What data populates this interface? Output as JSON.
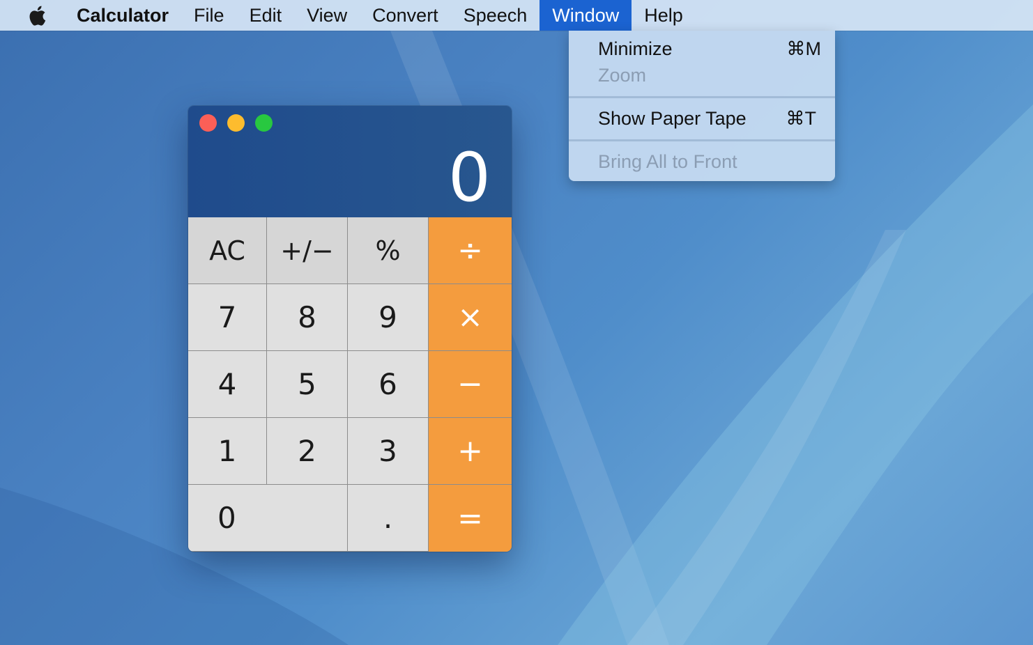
{
  "menubar": {
    "app_name": "Calculator",
    "items": [
      "File",
      "Edit",
      "View",
      "Convert",
      "Speech",
      "Window",
      "Help"
    ],
    "active": "Window"
  },
  "window_menu": {
    "minimize": {
      "label": "Minimize",
      "shortcut": "⌘M"
    },
    "zoom": {
      "label": "Zoom"
    },
    "paper_tape": {
      "label": "Show Paper Tape",
      "shortcut": "⌘T"
    },
    "bring_all": {
      "label": "Bring All to Front"
    }
  },
  "calculator": {
    "display_value": "0",
    "keys": {
      "ac": "AC",
      "sign": "+/−",
      "percent": "%",
      "divide": "÷",
      "seven": "7",
      "eight": "8",
      "nine": "9",
      "multiply": "×",
      "four": "4",
      "five": "5",
      "six": "6",
      "minus": "−",
      "one": "1",
      "two": "2",
      "three": "3",
      "plus": "+",
      "zero": "0",
      "decimal": ".",
      "equals": "="
    }
  },
  "colors": {
    "close": "#fc5f57",
    "minimize": "#fdbc2e",
    "zoom": "#28c840",
    "operator": "#f49c3e",
    "menu_highlight": "#1b63d1"
  }
}
